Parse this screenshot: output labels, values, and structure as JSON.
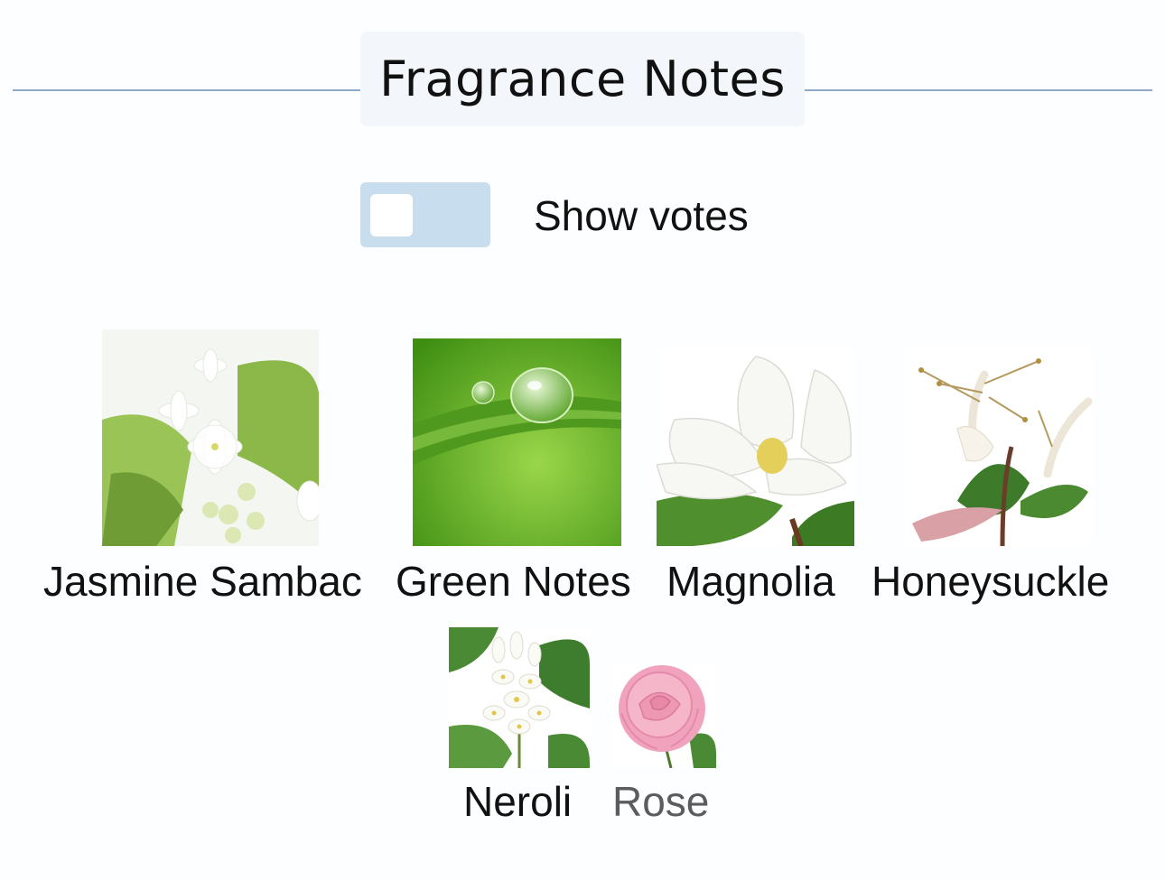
{
  "header": {
    "title": "Fragrance Notes"
  },
  "toggle": {
    "label": "Show votes",
    "on": false
  },
  "notes": [
    {
      "name": "Jasmine Sambac",
      "icon": "jasmine-flower-icon"
    },
    {
      "name": "Green Notes",
      "icon": "green-leaf-icon"
    },
    {
      "name": "Magnolia",
      "icon": "magnolia-flower-icon"
    },
    {
      "name": "Honeysuckle",
      "icon": "honeysuckle-flower-icon"
    },
    {
      "name": "Neroli",
      "icon": "neroli-flower-icon"
    },
    {
      "name": "Rose",
      "icon": "rose-flower-icon"
    }
  ],
  "colors": {
    "divider": "#8fa9c6",
    "title_background": "#f3f7fb",
    "toggle_track": "#c8deef",
    "dim_text": "#5c5c5c"
  }
}
